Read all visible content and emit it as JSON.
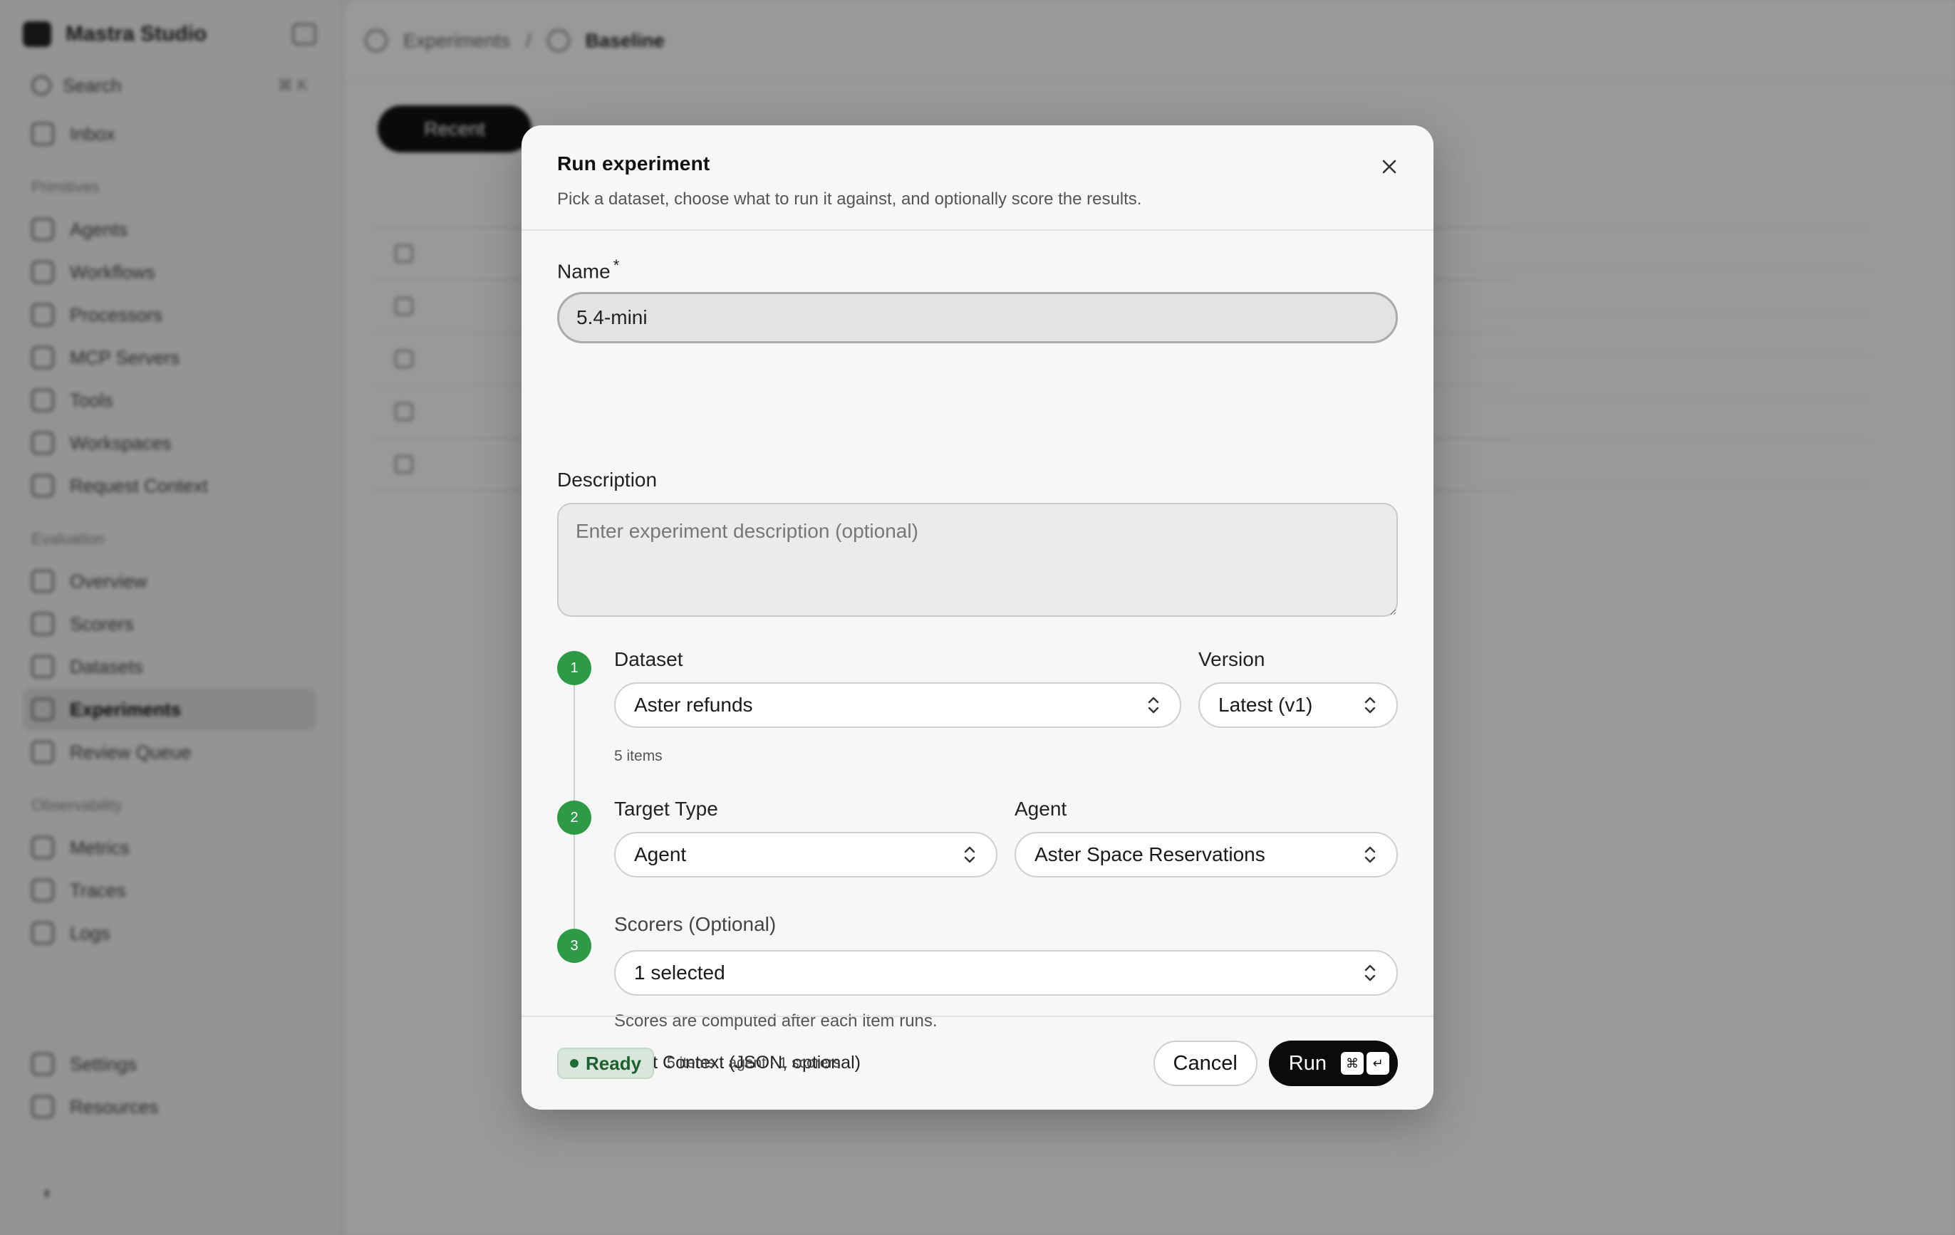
{
  "background": {
    "brand": "Mastra Studio",
    "search_label": "Search",
    "search_shortcut": "⌘ K",
    "nav_top": [
      "Inbox"
    ],
    "primitives_section": "Primitives",
    "primitives": [
      "Agents",
      "Workflows",
      "Processors",
      "MCP Servers",
      "Tools",
      "Workspaces",
      "Request Context"
    ],
    "evaluation_section": "Evaluation",
    "evaluation": [
      "Overview",
      "Scorers",
      "Datasets",
      "Experiments",
      "Review Queue"
    ],
    "observability_section": "Observability",
    "observability": [
      "Metrics",
      "Traces",
      "Logs"
    ],
    "bottom": [
      "Settings",
      "Resources"
    ],
    "breadcrumb": [
      "Experiments",
      "Baseline"
    ],
    "recent_button": "Recent"
  },
  "modal": {
    "title": "Run experiment",
    "subtitle": "Pick a dataset, choose what to run it against, and optionally score the results.",
    "name_label": "Name",
    "name_required_mark": "*",
    "name_value": "5.4-mini",
    "description_label": "Description",
    "description_placeholder": "Enter experiment description (optional)",
    "steps": {
      "one": "1",
      "two": "2",
      "three": "3"
    },
    "dataset_label": "Dataset",
    "dataset_value": "Aster refunds",
    "dataset_hint": "5 items",
    "version_label": "Version",
    "version_value": "Latest (v1)",
    "target_type_label": "Target Type",
    "target_type_value": "Agent",
    "agent_label": "Agent",
    "agent_value": "Aster Space Reservations",
    "scorers_label": "Scorers (Optional)",
    "scorers_value": "1 selected",
    "scorers_hint": "Scores are computed after each item runs.",
    "request_context_label": "Request Context (JSON, optional)",
    "status_badge": "Ready",
    "summary": "5 items · agent · 1 scorers",
    "cancel_label": "Cancel",
    "run_label": "Run",
    "run_shortcut_keys": [
      "⌘",
      "↵"
    ]
  },
  "colors": {
    "step_green": "#2e9a47",
    "ready_text": "#1f5e30",
    "run_button": "#0b0b0b"
  }
}
